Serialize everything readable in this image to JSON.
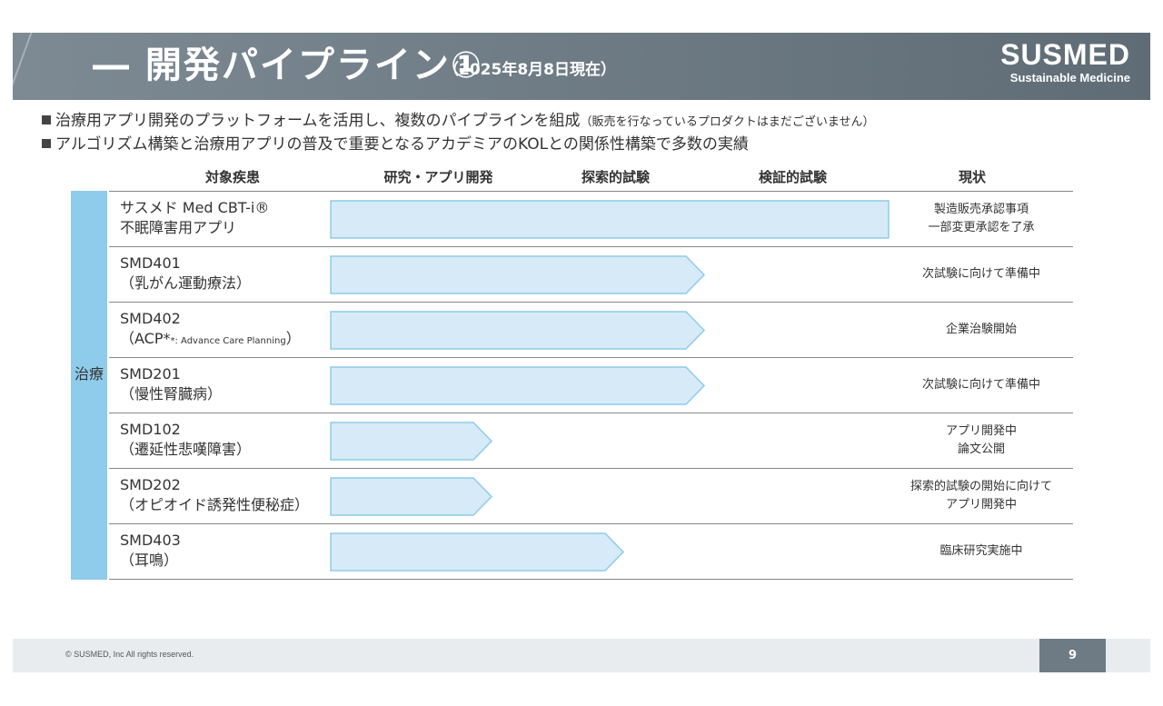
{
  "header": {
    "title": "― 開発パイプライン①",
    "subtitle": "（2025年8月8日現在）",
    "logo_main": "SUSMED",
    "logo_tagline": "Sustainable Medicine"
  },
  "bullets": [
    {
      "text": "治療用アプリ開発のプラットフォームを活用し、複数のパイプラインを組成",
      "note": "（販売を行なっているプロダクトはまだございません）"
    },
    {
      "text": "アルゴリズム構築と治療用アプリの普及で重要となるアカデミアのKOLとの関係性構築で多数の実績",
      "note": ""
    }
  ],
  "columns": {
    "disease": "対象疾患",
    "research": "研究・アプリ開発",
    "exploratory": "探索的試験",
    "confirmatory": "検証的試験",
    "status": "現状"
  },
  "category_label": "治療",
  "accent_color": "#8fcbea",
  "bar_fill": "#d6ebf7",
  "bar_stroke": "#8ecbea",
  "rows": [
    {
      "line1": "サスメド Med CBT-i®",
      "line2": "不眠障害用アプリ",
      "line2_small": "",
      "line2_end": "",
      "status1": "製造販売承認事項",
      "status2": "一部変更承認を了承",
      "progress": 1.0,
      "arrow": false
    },
    {
      "line1": "SMD401",
      "line2": "（乳がん運動療法）",
      "line2_small": "",
      "line2_end": "",
      "status1": "次試験に向けて準備中",
      "status2": "",
      "progress": 0.67,
      "arrow": true
    },
    {
      "line1": "SMD402",
      "line2": "（ACP*",
      "line2_small": "*: Advance Care Planning",
      "line2_end": "）",
      "status1": "企業治験開始",
      "status2": "",
      "progress": 0.67,
      "arrow": true
    },
    {
      "line1": "SMD201",
      "line2": "（慢性腎臓病）",
      "line2_small": "",
      "line2_end": "",
      "status1": "次試験に向けて準備中",
      "status2": "",
      "progress": 0.67,
      "arrow": true
    },
    {
      "line1": "SMD102",
      "line2": "（遷延性悲嘆障害）",
      "line2_small": "",
      "line2_end": "",
      "status1": "アプリ開発中",
      "status2": "論文公開",
      "progress": 0.29,
      "arrow": true
    },
    {
      "line1": "SMD202",
      "line2": "（オピオイド誘発性便秘症）",
      "line2_small": "",
      "line2_end": "",
      "status1": "探索的試験の開始に向けて",
      "status2": "アプリ開発中",
      "progress": 0.29,
      "arrow": true
    },
    {
      "line1": "SMD403",
      "line2": "（耳鳴）",
      "line2_small": "",
      "line2_end": "",
      "status1": "臨床研究実施中",
      "status2": "",
      "progress": 0.525,
      "arrow": true
    }
  ],
  "footer": {
    "copyright": "© SUSMED, Inc All rights reserved.",
    "page": "9"
  }
}
